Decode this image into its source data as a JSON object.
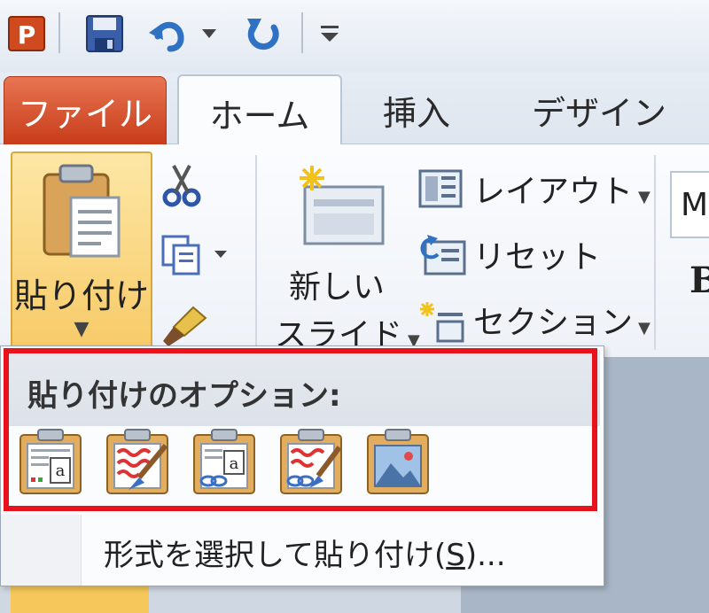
{
  "qat": {
    "icons": [
      "powerpoint-icon",
      "save-icon",
      "undo-icon",
      "redo-icon",
      "customize-icon"
    ]
  },
  "tabs": {
    "file": "ファイル",
    "home": "ホーム",
    "insert": "挿入",
    "design": "デザイン"
  },
  "ribbon": {
    "paste_label": "貼り付け",
    "new_slide_line1": "新しい",
    "new_slide_line2": "スライド",
    "layout": "レイアウト",
    "reset": "リセット",
    "section": "セクション",
    "font_box": "M",
    "bold": "B"
  },
  "menu": {
    "header": "貼り付けのオプション:",
    "paste_special_prefix": "形式を選択して貼り付け(",
    "paste_special_key": "S",
    "paste_special_suffix": ")..."
  },
  "colors": {
    "file_tab": "#d2502a",
    "highlight_border": "#e8121c",
    "paste_button": "#f7c964"
  }
}
